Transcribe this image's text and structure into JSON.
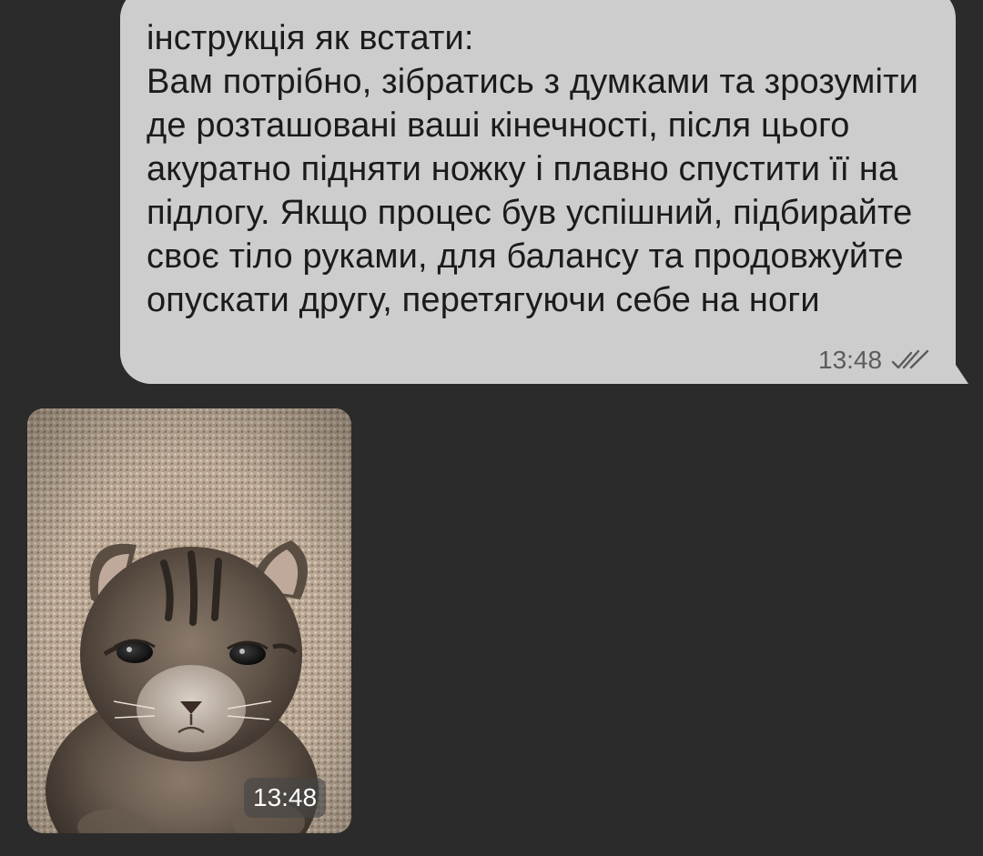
{
  "outgoing_message": {
    "text": "інструкція як встати:\nВам потрібно, зібратись з думками та зрозуміти де розташовані ваші кінечності, після цього акуратно підняти ножку і плавно спустити її на підлогу. Якщо процес був успішний, підбирайте своє тіло руками, для балансу та продовжуйте опускати другу, перетягуючи себе на ноги",
    "time": "13:48",
    "status_icon": "double-check-icon"
  },
  "incoming_photo": {
    "time": "13:48"
  },
  "colors": {
    "background": "#2b2b2b",
    "outgoing_bubble": "#cdcdcd",
    "message_text": "#1b1b1b",
    "meta_text": "#5c5c5c"
  }
}
